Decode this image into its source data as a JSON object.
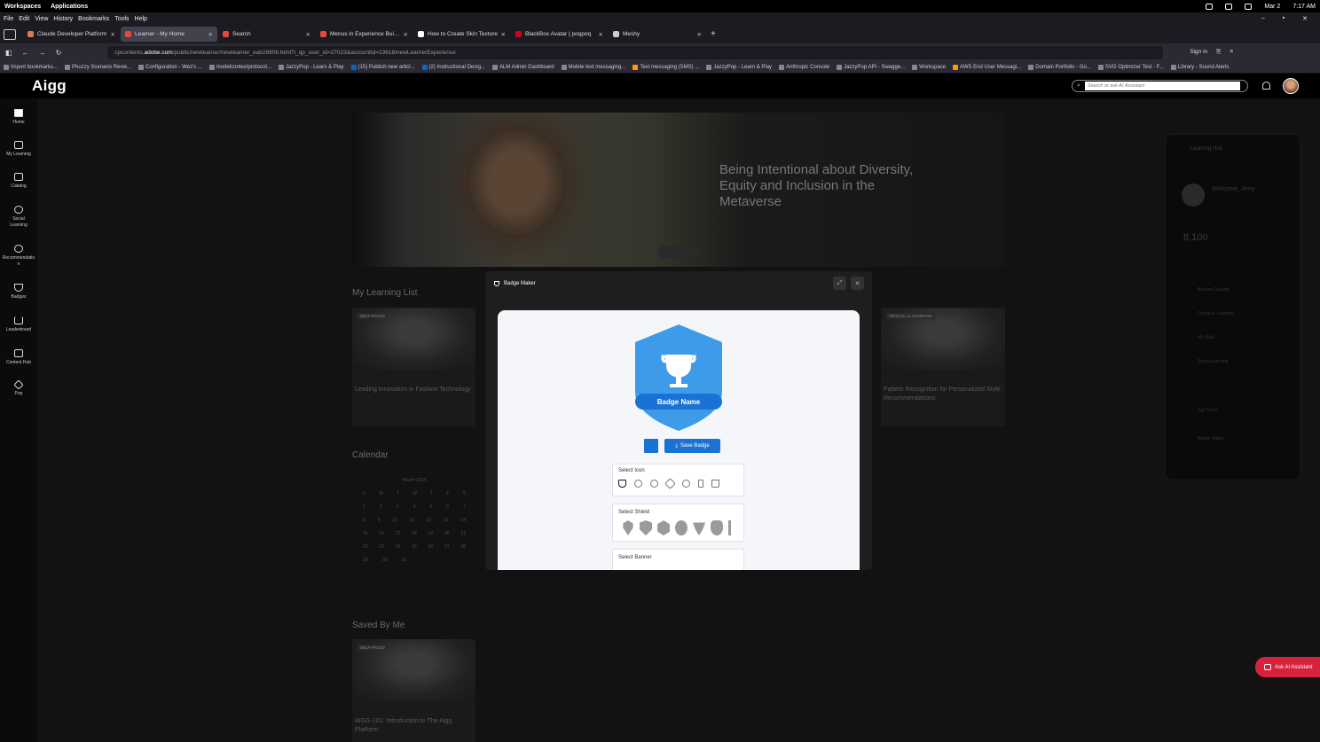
{
  "os": {
    "workspaces": "Workspaces",
    "applications": "Applications",
    "date": "Mar 2",
    "time": "7:17 AM"
  },
  "menu": [
    "File",
    "Edit",
    "View",
    "History",
    "Bookmarks",
    "Tools",
    "Help"
  ],
  "tabs": [
    {
      "label": "Claude Developer Platform",
      "color": "#d97757",
      "active": false
    },
    {
      "label": "Learner - My Home",
      "color": "#e8473c",
      "active": true
    },
    {
      "label": "Search",
      "color": "#e8473c",
      "active": false
    },
    {
      "label": "Menus in Experience Builde",
      "color": "#e8473c",
      "active": false
    },
    {
      "label": "How to Create Skin Texture",
      "color": "#ffffff",
      "active": false
    },
    {
      "label": "BlackBox Avatar | poqpoq",
      "color": "#d0021b",
      "active": false
    },
    {
      "label": "Meshy",
      "color": "#cccccc",
      "active": false
    }
  ],
  "url": {
    "prefix": "cpcontents.",
    "domain": "adobe.com",
    "path": "/public/newlearner/newlearner_eab28806.html?i_qp_user_id=27023&accountId=13618/newLearnerExperience",
    "signin": "Sign in"
  },
  "bookmarks": [
    "Import bookmarks...",
    "Phuzzy Scenario Revie...",
    "Configuration - Wez's ...",
    "modelcontextprotocol...",
    "JazzyPop - Learn & Play",
    "(15) Publish new articl...",
    "(2) Instructional Desig...",
    "ALM Admin Dashboard",
    "Mobile text messaging...",
    "Text messaging (SMS) ...",
    "JazzyPop - Learn & Play",
    "Anthropic Console",
    "JazzyPop API - Swagge...",
    "Workspace",
    "AWS End User Messagi...",
    "Domain Portfolio - Go...",
    "SVG Optimizer Test - F...",
    "Library - Sound Alerts"
  ],
  "app": {
    "logo": "Aigg",
    "search_placeholder": "Search or ask AI Assistant"
  },
  "sidebar": [
    {
      "label": "Home"
    },
    {
      "label": "My Learning"
    },
    {
      "label": "Catalog"
    },
    {
      "label": "Social Learning"
    },
    {
      "label": "Recommendation"
    },
    {
      "label": "Badges"
    },
    {
      "label": "Leaderboard"
    },
    {
      "label": "Content Hub"
    },
    {
      "label": "Pop"
    }
  ],
  "hero": {
    "headline": "Being Intentional about Diversity, Equity and Inclusion in the Metaverse"
  },
  "sections": {
    "learning_list": "My Learning List",
    "calendar": "Calendar",
    "saved": "Saved By Me"
  },
  "cards": [
    {
      "tag": "SELF-PACED",
      "title": "Leading Innovation in Fashion Technology"
    },
    {
      "tag": "VIRTUAL CLASSROOM",
      "title": "Pattern Recognition for Personalized Style Recommendations"
    },
    {
      "tag": "SELF-PACED",
      "title": "AIGG-101: Introduction to The Aigg Platform"
    }
  ],
  "calendar": {
    "month": "March 2024",
    "weekdays": [
      "S",
      "M",
      "T",
      "W",
      "T",
      "F",
      "S"
    ],
    "rows": [
      [
        "1",
        "2",
        "3",
        "4",
        "5",
        "6",
        "7"
      ],
      [
        "8",
        "9",
        "10",
        "11",
        "12",
        "13",
        "14"
      ],
      [
        "15",
        "16",
        "17",
        "18",
        "19",
        "20",
        "21"
      ],
      [
        "22",
        "23",
        "24",
        "25",
        "26",
        "27",
        "28"
      ],
      [
        "29",
        "30",
        "31",
        "",
        "",
        "",
        ""
      ]
    ]
  },
  "rpanel": {
    "title": "Learning Hub",
    "welcome": "Welcome, Jerry",
    "points": "8,100",
    "items": [
      "Browse Catalog",
      "Continue Learning",
      "My Skills",
      "Social Learning",
      "Top Three",
      "Badge Maker"
    ]
  },
  "ask_ai": "Ask AI Assistant",
  "modal": {
    "title": "Badge Maker",
    "badge_name": "Badge Name",
    "save_label": "Save Badge",
    "select_icon": "Select Icon",
    "select_shield": "Select Shield",
    "select_banner": "Select Banner",
    "colors": {
      "badge": "#3d9be9",
      "banner": "#1a73d4",
      "save": "#1a73d4"
    },
    "icons": [
      "trophy-icon",
      "medal-icon",
      "award-icon",
      "rocket-icon",
      "check-circle-icon",
      "torch-icon",
      "flask-icon"
    ]
  }
}
